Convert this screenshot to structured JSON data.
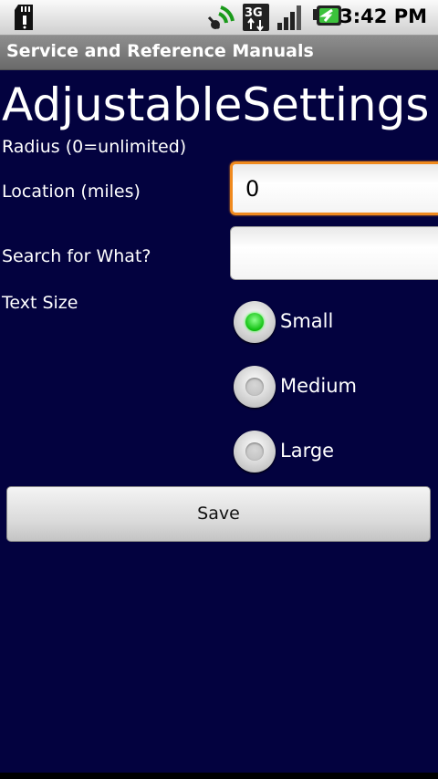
{
  "status_bar": {
    "time": "3:42 PM",
    "icons": [
      "sd-card-icon",
      "signal-wave-icon",
      "3g-data-icon",
      "signal-bars-icon",
      "battery-charging-icon"
    ],
    "network_label": "3G"
  },
  "app": {
    "title": "Service and Reference Manuals"
  },
  "page": {
    "heading": "AdjustableSettings",
    "radius_label": "Radius (0=unlimited)",
    "location_label": "Location (miles)",
    "location_value": "0",
    "search_label": "Search for What?",
    "search_value": "",
    "text_size_label": "Text Size",
    "text_size_options": [
      "Small",
      "Medium",
      "Large"
    ],
    "text_size_selected": "Small",
    "save_label": "Save"
  },
  "colors": {
    "background": "#03023f",
    "focus_border": "#f08a1e",
    "radio_selected": "#10c010"
  }
}
